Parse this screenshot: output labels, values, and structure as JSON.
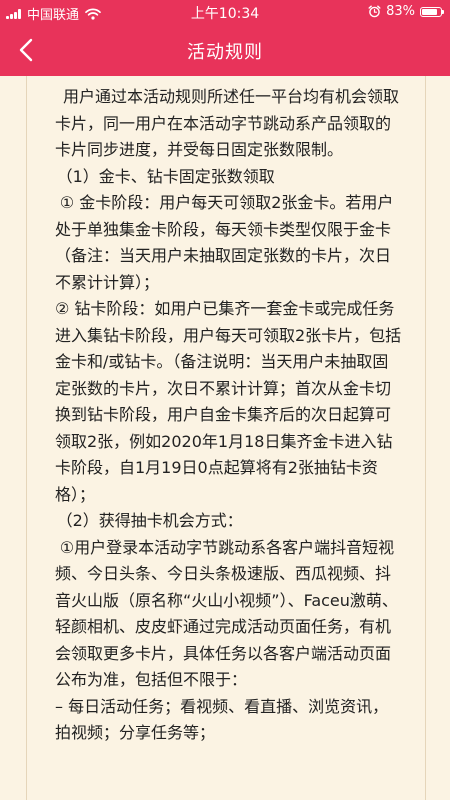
{
  "status_bar": {
    "carrier": "中国联通",
    "time": "上午10:34",
    "battery_level": "83%",
    "battery_fraction": 0.83
  },
  "nav": {
    "title": "活动规则"
  },
  "rules": {
    "paragraphs": [
      "用户通过本活动规则所述任一平台均有机会领取卡片，同一用户在本活动字节跳动系产品领取的卡片同步进度，并受每日固定张数限制。",
      "（1）金卡、钻卡固定张数领取",
      "① 金卡阶段：用户每天可领取2张金卡。若用户处于单独集金卡阶段，每天领卡类型仅限于金卡（备注：当天用户未抽取固定张数的卡片，次日不累计计算）；",
      "② 钻卡阶段：如用户已集齐一套金卡或完成任务进入集钻卡阶段，用户每天可领取2张卡片，包括金卡和/或钻卡。（备注说明：当天用户未抽取固定张数的卡片，次日不累计计算；首次从金卡切换到钻卡阶段，用户自金卡集齐后的次日起算可领取2张，例如2020年1月18日集齐金卡进入钻卡阶段，自1月19日0点起算将有2张抽钻卡资格）；",
      "（2）获得抽卡机会方式：",
      "①用户登录本活动字节跳动系各客户端抖音短视频、今日头条、今日头条极速版、西瓜视频、抖音火山版（原名称“火山小视频”）、Faceu激萌、轻颜相机、皮皮虾通过完成活动页面任务，有机会领取更多卡片，具体任务以各客户端活动页面公布为准，包括但不限于：",
      "– 每日活动任务；看视频、看直播、浏览资讯，拍视频；分享任务等；"
    ]
  }
}
